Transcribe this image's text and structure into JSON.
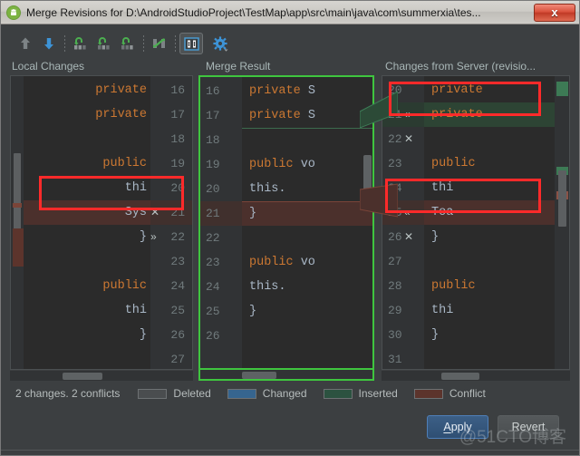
{
  "window": {
    "title": "Merge Revisions for D:\\AndroidStudioProject\\TestMap\\app\\src\\main\\java\\com\\summerxia\\tes...",
    "app_icon": "android-studio-icon",
    "close_label": "x"
  },
  "toolbar": {
    "items": [
      {
        "name": "previous-difference-button",
        "icon": "arrow-up-icon",
        "tooltip": "Previous Difference",
        "active": false
      },
      {
        "name": "next-difference-button",
        "icon": "arrow-down-icon",
        "tooltip": "Next Difference",
        "active": false
      },
      {
        "name": "apply-left-button",
        "icon": "apply-non-conflicting-left-icon",
        "tooltip": "Apply Non-Conflicting Changes from the Left Side",
        "active": false
      },
      {
        "name": "apply-both-button",
        "icon": "apply-non-conflicting-icon",
        "tooltip": "Apply All Non-Conflicting Changes",
        "active": false
      },
      {
        "name": "apply-right-button",
        "icon": "apply-non-conflicting-right-icon",
        "tooltip": "Apply Non-Conflicting Changes from the Right Side",
        "active": false
      },
      {
        "name": "magic-resolve-button",
        "icon": "magic-resolve-icon",
        "tooltip": "Magic Resolve",
        "active": false
      },
      {
        "name": "toggle-columns-button",
        "icon": "side-by-side-viewer-icon",
        "tooltip": "Viewer Mode",
        "active": true
      },
      {
        "name": "settings-button",
        "icon": "gear-icon",
        "tooltip": "Settings",
        "active": false
      }
    ]
  },
  "panes": {
    "left": {
      "title": "Local Changes",
      "lines": [
        {
          "num": "16",
          "code": "private",
          "kind": "normal"
        },
        {
          "num": "17",
          "code": "private",
          "kind": "normal"
        },
        {
          "num": "18",
          "code": "",
          "kind": "normal"
        },
        {
          "num": "19",
          "code": "public",
          "kind": "normal"
        },
        {
          "num": "20",
          "code": "thi",
          "kind": "normal"
        },
        {
          "num": "21",
          "code": "Sys",
          "kind": "conflict",
          "actions": "✕ »"
        },
        {
          "num": "22",
          "code": "}",
          "kind": "normal"
        },
        {
          "num": "23",
          "code": "",
          "kind": "normal"
        },
        {
          "num": "24",
          "code": "public",
          "kind": "normal"
        },
        {
          "num": "25",
          "code": "thi",
          "kind": "normal"
        },
        {
          "num": "26",
          "code": "}",
          "kind": "normal"
        },
        {
          "num": "27",
          "code": "",
          "kind": "normal"
        }
      ]
    },
    "middle": {
      "title": "Merge Result",
      "lines": [
        {
          "num": "16",
          "code": "private S",
          "kind": "normal"
        },
        {
          "num": "17",
          "code": "private S",
          "kind": "normal"
        },
        {
          "num": "18",
          "code": "",
          "kind": "normal"
        },
        {
          "num": "19",
          "code": "public vo",
          "kind": "normal"
        },
        {
          "num": "20",
          "code": "this.",
          "kind": "normal"
        },
        {
          "num": "21",
          "code": "}",
          "kind": "conflict"
        },
        {
          "num": "22",
          "code": "",
          "kind": "normal"
        },
        {
          "num": "23",
          "code": "public vo",
          "kind": "normal"
        },
        {
          "num": "24",
          "code": "this.",
          "kind": "normal"
        },
        {
          "num": "25",
          "code": "}",
          "kind": "normal"
        },
        {
          "num": "26",
          "code": "",
          "kind": "normal"
        }
      ]
    },
    "right": {
      "title": "Changes from Server (revisio...",
      "lines": [
        {
          "num": "20",
          "code": "private",
          "kind": "normal"
        },
        {
          "num": "21",
          "code": "private",
          "kind": "insert",
          "actions": "« ✕"
        },
        {
          "num": "22",
          "code": "",
          "kind": "normal"
        },
        {
          "num": "23",
          "code": "public",
          "kind": "normal"
        },
        {
          "num": "24",
          "code": "thi",
          "kind": "normal"
        },
        {
          "num": "25",
          "code": "Toa",
          "kind": "conflict",
          "actions": "« ✕"
        },
        {
          "num": "26",
          "code": "}",
          "kind": "normal"
        },
        {
          "num": "27",
          "code": "",
          "kind": "normal"
        },
        {
          "num": "28",
          "code": "public",
          "kind": "normal"
        },
        {
          "num": "29",
          "code": "thi",
          "kind": "normal"
        },
        {
          "num": "30",
          "code": "}",
          "kind": "normal"
        },
        {
          "num": "31",
          "code": "",
          "kind": "normal"
        }
      ]
    }
  },
  "legend": {
    "status": "2 changes. 2 conflicts",
    "items": [
      {
        "label": "Deleted",
        "color": "#4a4d4f"
      },
      {
        "label": "Changed",
        "color": "#36658f"
      },
      {
        "label": "Inserted",
        "color": "#2c5240"
      },
      {
        "label": "Conflict",
        "color": "#5c342c"
      }
    ]
  },
  "buttons": {
    "apply": "Apply",
    "apply_mnemonic": "A",
    "apply_rest": "pply",
    "revert": "Revert"
  },
  "watermark": "@51CTO博客",
  "colors": {
    "accent_focus": "#3fc53f",
    "annotation": "#ff2a2a",
    "keyword": "#cc7832",
    "plain": "#a9b7c6",
    "editor_bg": "#2b2b2b",
    "gutter_bg": "#313335",
    "panel_bg": "#3c3f41"
  }
}
